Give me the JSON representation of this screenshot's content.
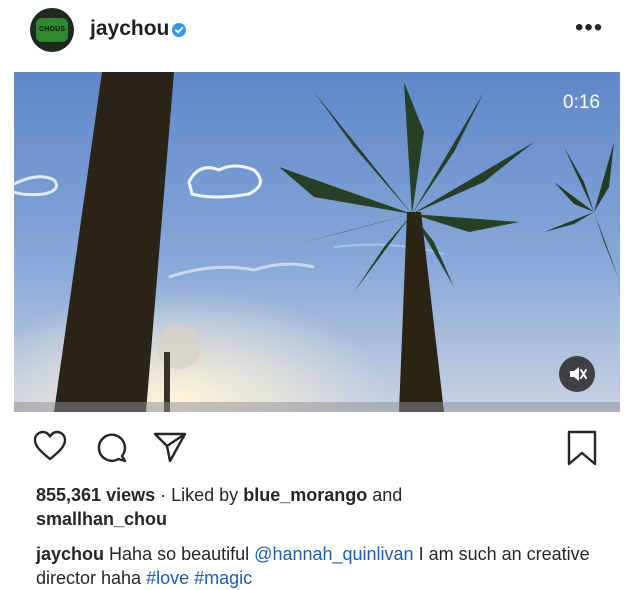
{
  "post": {
    "username": "jaychou",
    "avatar_text": "CHOUS",
    "video": {
      "timer": "0:16"
    },
    "views_count": "855,361 views",
    "liked_prefix": "Liked by",
    "liked_user_1": "blue_morango",
    "liked_and": "and",
    "liked_user_2": "smallhan_chou",
    "caption": {
      "author": "jaychou",
      "text_1": "Haha so beautiful",
      "mention": "@hannah_quinlivan",
      "text_2": "I am such an creative director haha",
      "hashtag_1": "#love",
      "hashtag_2": "#magic"
    }
  },
  "icons": {
    "more": "more-options-icon",
    "verified": "verified-badge-icon",
    "like": "heart-icon",
    "comment": "comment-icon",
    "share": "send-icon",
    "save": "bookmark-icon",
    "mute": "speaker-muted-icon"
  },
  "colors": {
    "link": "#1a5fb4",
    "verified": "#3897f0",
    "text": "#262626"
  }
}
